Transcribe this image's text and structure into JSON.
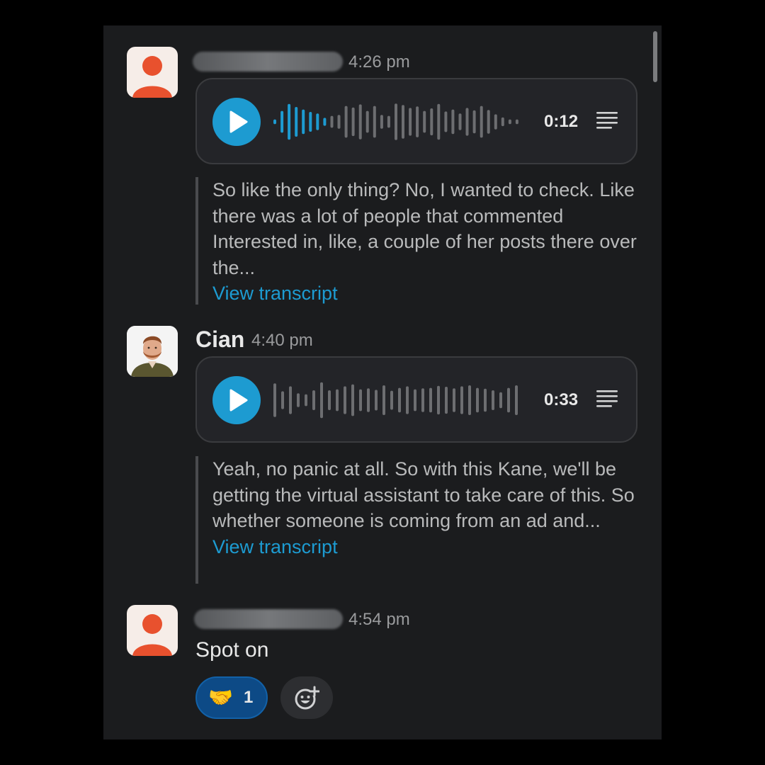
{
  "messages": [
    {
      "author": "",
      "time": "4:26 pm",
      "audio": {
        "duration": "0:12",
        "progress": 0.22
      },
      "transcript": "So like the only thing? No, I wanted to check. Like there was a lot of people that commented Interested in, like, a couple of her posts there over the...",
      "view_transcript": "View transcript"
    },
    {
      "author": "Cian",
      "time": "4:40 pm",
      "audio": {
        "duration": "0:33",
        "progress": 0.0
      },
      "transcript": "Yeah, no panic at all. So with this Kane, we'll be getting the virtual assistant to take care of this. So whether someone is coming from an ad and...",
      "view_transcript": "View transcript"
    },
    {
      "author": "",
      "time": "4:54 pm",
      "text": "Spot on",
      "reactions": [
        {
          "emoji": "🤝",
          "count": "1"
        }
      ]
    }
  ],
  "colors": {
    "accent": "#1d9bd1",
    "background": "#1b1c1e",
    "reaction_active": "#0d4a86",
    "avatar_generic": "#e8512e"
  },
  "icons": {
    "play": "play-icon",
    "transcript": "lines-icon",
    "add_reaction": "add-emoji-icon"
  }
}
